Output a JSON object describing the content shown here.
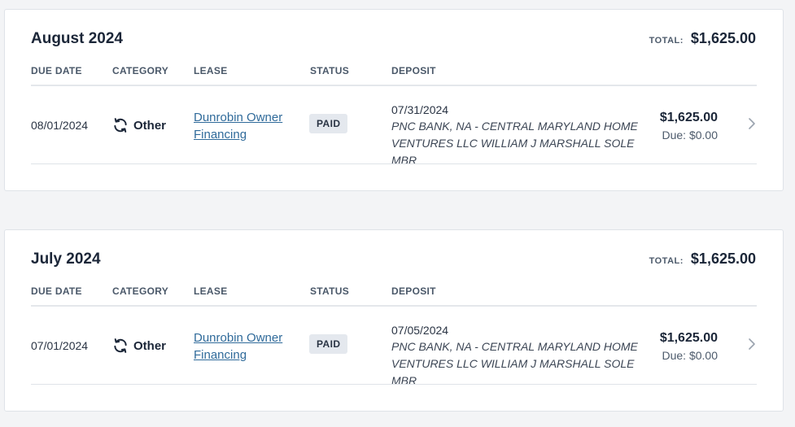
{
  "columns": {
    "due_date": "DUE DATE",
    "category": "CATEGORY",
    "lease": "LEASE",
    "status": "STATUS",
    "deposit": "DEPOSIT"
  },
  "total_label": "TOTAL:",
  "icons": {
    "category": "refresh-icon",
    "row_action": "chevron-right-icon"
  },
  "colors": {
    "link": "#2f6a9a",
    "badge_bg": "#e4e8ee",
    "page_bg": "#f3f4f6"
  },
  "months": [
    {
      "title": "August 2024",
      "total": "$1,625.00",
      "row": {
        "due_date": "08/01/2024",
        "category": "Other",
        "lease_line1": "Dunrobin Owner",
        "lease_line2": "Financing",
        "status": "PAID",
        "deposit_date": "07/31/2024",
        "deposit_line1": "PNC BANK, NA - CENTRAL MARYLAND HOME",
        "deposit_line2": "VENTURES LLC WILLIAM J MARSHALL SOLE MBR",
        "amount": "$1,625.00",
        "amount_due": "Due: $0.00"
      }
    },
    {
      "title": "July 2024",
      "total": "$1,625.00",
      "row": {
        "due_date": "07/01/2024",
        "category": "Other",
        "lease_line1": "Dunrobin Owner",
        "lease_line2": "Financing",
        "status": "PAID",
        "deposit_date": "07/05/2024",
        "deposit_line1": "PNC BANK, NA - CENTRAL MARYLAND HOME",
        "deposit_line2": "VENTURES LLC WILLIAM J MARSHALL SOLE MBR",
        "amount": "$1,625.00",
        "amount_due": "Due: $0.00"
      }
    }
  ]
}
